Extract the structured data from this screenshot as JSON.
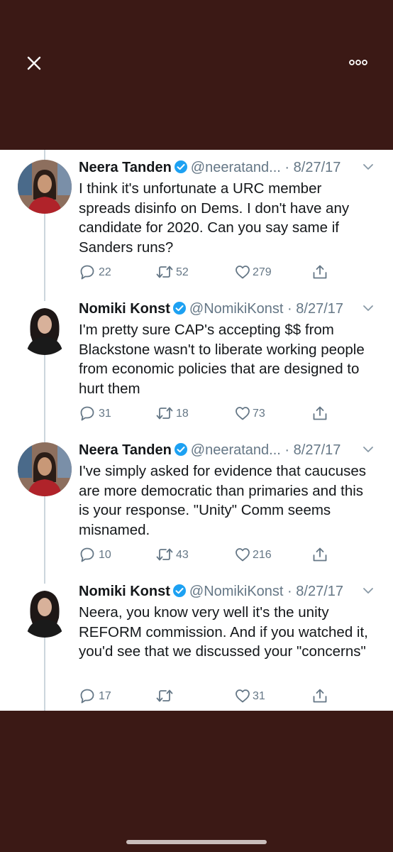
{
  "colors": {
    "background": "#3b1915",
    "card": "#ffffff",
    "verified": "#1da1f2",
    "secondary_text": "#657786",
    "thread_line": "#ccd6dd"
  },
  "toolbar": {
    "close_icon": "close-icon",
    "more_icon": "more-options-icon"
  },
  "tweets": [
    {
      "name": "Neera Tanden",
      "handle": "@neeratand...",
      "separator": "·",
      "date": "8/27/17",
      "text": "I think it's unfortunate a URC member spreads disinfo on Dems. I don't have any candidate for 2020. Can you say same if Sanders runs?",
      "replies": "22",
      "retweets": "52",
      "likes": "279"
    },
    {
      "name": "Nomiki Konst",
      "handle": "@NomikiKonst",
      "separator": "·",
      "date": "8/27/17",
      "text": "I'm pretty sure CAP's accepting $$ from Blackstone wasn't to liberate working people from economic policies that are designed to hurt them",
      "replies": "31",
      "retweets": "18",
      "likes": "73"
    },
    {
      "name": "Neera Tanden",
      "handle": "@neeratand...",
      "separator": "·",
      "date": "8/27/17",
      "text": "I've simply asked for evidence that caucuses are more democratic than primaries and this is your response. \"Unity\" Comm seems misnamed.",
      "replies": "10",
      "retweets": "43",
      "likes": "216"
    },
    {
      "name": "Nomiki Konst",
      "handle": "@NomikiKonst",
      "separator": "·",
      "date": "8/27/17",
      "text": "Neera, you know very well it's the unity REFORM commission. And if you watched it, you'd see that we discussed your \"concerns\"",
      "replies": "17",
      "retweets": "",
      "likes": "31"
    }
  ]
}
